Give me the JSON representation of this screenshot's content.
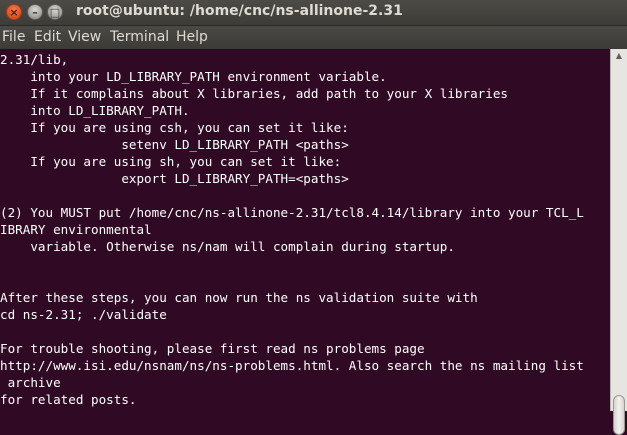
{
  "window": {
    "title": "root@ubuntu: /home/cnc/ns-allinone-2.31",
    "close_glyph": "×",
    "minimize_glyph": "–",
    "maximize_glyph": "□"
  },
  "menubar": [
    "File",
    "Edit",
    "View",
    "Terminal",
    "Help"
  ],
  "scrollbar": {
    "up_glyph": "▲"
  },
  "terminal": {
    "background": "#300a24",
    "foreground": "#ffffff",
    "lines": [
      "2.31/lib,",
      "    into your LD_LIBRARY_PATH environment variable.",
      "    If it complains about X libraries, add path to your X libraries",
      "    into LD_LIBRARY_PATH.",
      "    If you are using csh, you can set it like:",
      "                setenv LD_LIBRARY_PATH <paths>",
      "    If you are using sh, you can set it like:",
      "                export LD_LIBRARY_PATH=<paths>",
      "",
      "(2) You MUST put /home/cnc/ns-allinone-2.31/tcl8.4.14/library into your TCL_L",
      "IBRARY environmental",
      "    variable. Otherwise ns/nam will complain during startup.",
      "",
      "",
      "After these steps, you can now run the ns validation suite with",
      "cd ns-2.31; ./validate",
      "",
      "For trouble shooting, please first read ns problems page",
      "http://www.isi.edu/nsnam/ns/ns-problems.html. Also search the ns mailing list",
      " archive",
      "for related posts."
    ]
  }
}
